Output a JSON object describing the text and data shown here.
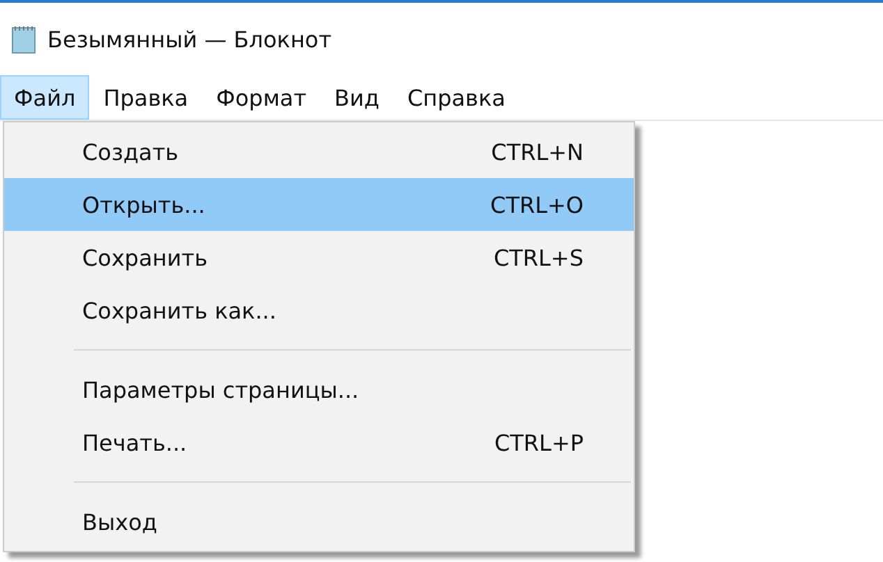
{
  "window": {
    "title": "Безымянный — Блокнот"
  },
  "menu_bar": [
    {
      "label": "Файл",
      "selected": true
    },
    {
      "label": "Правка",
      "selected": false
    },
    {
      "label": "Формат",
      "selected": false
    },
    {
      "label": "Вид",
      "selected": false
    },
    {
      "label": "Справка",
      "selected": false
    }
  ],
  "file_menu": [
    {
      "kind": "item",
      "label": "Создать",
      "shortcut": "CTRL+N",
      "selected": false
    },
    {
      "kind": "item",
      "label": "Открыть...",
      "shortcut": "CTRL+O",
      "selected": true
    },
    {
      "kind": "item",
      "label": "Сохранить",
      "shortcut": "CTRL+S",
      "selected": false
    },
    {
      "kind": "item",
      "label": "Сохранить как...",
      "selected": false
    },
    {
      "kind": "separator"
    },
    {
      "kind": "item",
      "label": "Параметры страницы...",
      "selected": false
    },
    {
      "kind": "item",
      "label": "Печать...",
      "shortcut": "CTRL+P",
      "selected": false
    },
    {
      "kind": "separator"
    },
    {
      "kind": "item",
      "label": "Выход",
      "selected": false
    }
  ]
}
